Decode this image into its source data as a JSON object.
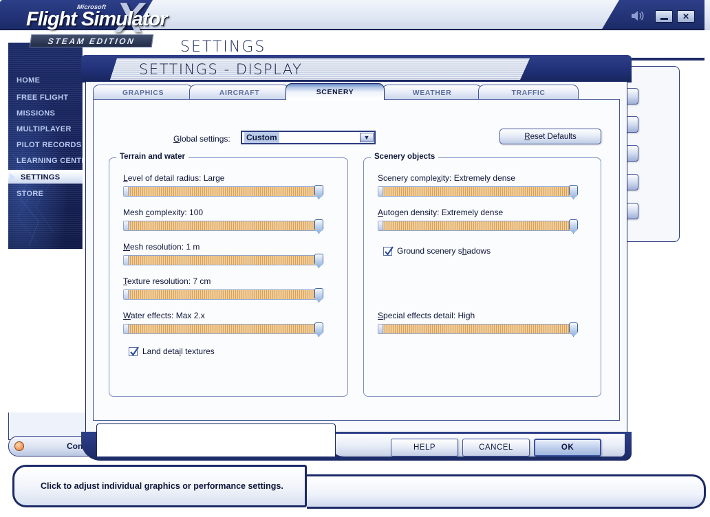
{
  "app": {
    "logo_microsoft": "Microsoft",
    "logo_title": "Flight Simulator",
    "logo_x": "X",
    "logo_edition": "STEAM EDITION",
    "page_title": "SETTINGS",
    "sound_icon": "speaker-icon",
    "minimize_label": "",
    "close_label": "✕"
  },
  "sidebar": {
    "items": [
      {
        "label": "HOME",
        "active": false
      },
      {
        "label": "FREE FLIGHT",
        "active": false
      },
      {
        "label": "MISSIONS",
        "active": false
      },
      {
        "label": "MULTIPLAYER",
        "active": false
      },
      {
        "label": "PILOT RECORDS",
        "active": false
      },
      {
        "label": "LEARNING CENTER",
        "active": false
      },
      {
        "label": "SETTINGS",
        "active": true
      },
      {
        "label": "STORE",
        "active": false
      }
    ]
  },
  "dialog": {
    "title": "SETTINGS - DISPLAY",
    "tabs": [
      {
        "label": "GRAPHICS",
        "active": false
      },
      {
        "label": "AIRCRAFT",
        "active": false
      },
      {
        "label": "SCENERY",
        "active": true
      },
      {
        "label": "WEATHER",
        "active": false
      },
      {
        "label": "TRAFFIC",
        "active": false
      }
    ],
    "global_settings": {
      "label_pre": "G",
      "label_post": "lobal settings:",
      "value": "Custom"
    },
    "reset_button": {
      "accel": "R",
      "rest": "eset Defaults"
    },
    "groups": {
      "left": {
        "legend": "Terrain and water",
        "sliders": [
          {
            "pre": "L",
            "mid": "",
            "post": "evel of detail radius: Large",
            "value_pct": 100
          },
          {
            "pre": "Mesh ",
            "mid": "c",
            "post": "omplexity: 100",
            "value_pct": 100
          },
          {
            "pre": "",
            "mid": "M",
            "post": "esh resolution: 1 m",
            "value_pct": 100
          },
          {
            "pre": "",
            "mid": "T",
            "post": "exture resolution: 7 cm",
            "value_pct": 100
          },
          {
            "pre": "",
            "mid": "W",
            "post": "ater effects: Max 2.x",
            "value_pct": 100
          }
        ],
        "checkbox": {
          "pre": "Land deta",
          "accel": "i",
          "post": "l textures",
          "checked": true
        }
      },
      "right": {
        "legend": "Scenery objects",
        "sliders": [
          {
            "pre": "Scenery comple",
            "mid": "x",
            "post": "ity: Extremely dense",
            "value_pct": 100
          },
          {
            "pre": "",
            "mid": "A",
            "post": "utogen density: Extremely dense",
            "value_pct": 100
          },
          {
            "pre": "",
            "mid": "S",
            "post": "pecial effects detail: High",
            "value_pct": 100
          }
        ],
        "checkbox": {
          "pre": "Ground scenery s",
          "accel": "h",
          "post": "adows",
          "checked": true
        }
      }
    },
    "footer_buttons": [
      {
        "label": "HELP",
        "primary": false
      },
      {
        "label": "CANCEL",
        "primary": false
      },
      {
        "label": "OK",
        "primary": true
      }
    ]
  },
  "contacts": {
    "label": "Contacts"
  },
  "status": {
    "text": "Click to adjust individual graphics or performance settings."
  },
  "colors": {
    "brand_blue": "#1b2a66",
    "accent_blue": "#2d3f88",
    "slider_track": "#e0b277",
    "panel_bg": "#fbfcfe"
  }
}
